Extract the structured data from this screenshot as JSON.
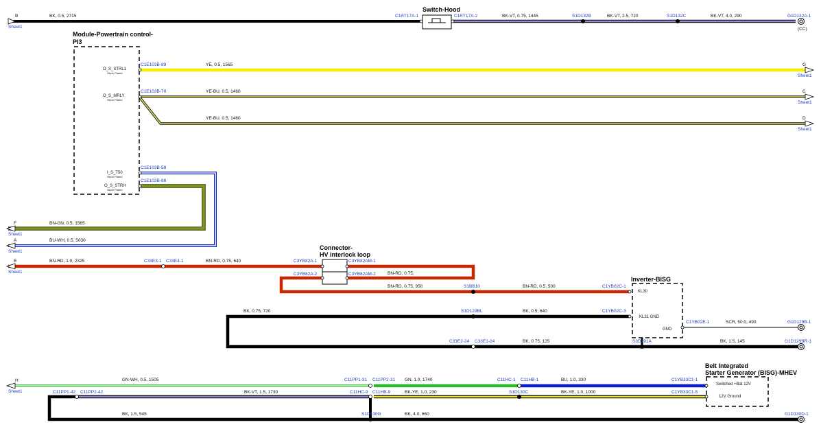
{
  "wires": {
    "w1": {
      "label": "BK, 0.5, 2715"
    },
    "w2": {
      "label": "BK-VT, 0.75, 1445"
    },
    "w3": {
      "label": "BK-VT, 2.5, 720"
    },
    "w4": {
      "label": "BK-VT, 4.0, 290"
    },
    "w5": {
      "label": "YE, 0.5, 1565"
    },
    "w6": {
      "label": "YE-BU, 0.5, 1460"
    },
    "w7": {
      "label": "YE-BU, 0.5, 1460"
    },
    "w8": {
      "label": "BN-GN, 0.5, 1565"
    },
    "w9": {
      "label": "BU-WH, 0.5, 5030"
    },
    "w10": {
      "label": "BN-RD, 1.0, 2325"
    },
    "w11": {
      "label": "BN-RD, 0.75, 640"
    },
    "w12": {
      "label": "BN-RD, 0.75,"
    },
    "w13": {
      "label": "BN-RD, 0.75, 950"
    },
    "w14": {
      "label": "BN-RD, 0.5, 500"
    },
    "w15": {
      "label": "BK, 0.75, 720"
    },
    "w16": {
      "label": "BK, 0.5, 640"
    },
    "w17": {
      "label": "SCR, 50.0, 490"
    },
    "w18": {
      "label": "BK, 0.75, 125"
    },
    "w19": {
      "label": "BK, 1.5, 145"
    },
    "w20": {
      "label": "GN-WH, 0.5, 1505"
    },
    "w21": {
      "label": "GN, 1.0, 1740"
    },
    "w22": {
      "label": "BU, 1.0, 330"
    },
    "w23": {
      "label": "BK-VT, 1.5, 1730"
    },
    "w24": {
      "label": "BK-YE, 1.0, 230"
    },
    "w25": {
      "label": "BK-YE, 1.0, 1000"
    },
    "w26": {
      "label": "BK, 1.5, 545"
    },
    "w27": {
      "label": "BK, 4.0, 660"
    }
  },
  "connectors": {
    "c1": "C1RT17A-1",
    "c2": "C1RT17A-2",
    "c3": "S1D132B",
    "c4": "S1D132C",
    "c5": "G1D132A-1",
    "c6": "C1E103B-89",
    "c7": "C1E103B-70",
    "c8": "C1E103B-58",
    "c9": "C1E103B-86",
    "c10": "C33E3-1",
    "c11": "C33E4-1",
    "c12": "C3YB82A-1",
    "c13": "C3YB82AM-1",
    "c14": "C3YB82A-2",
    "c15": "C3YB82AM-2",
    "c16": "S1BB10",
    "c17": "C1YB02C-1",
    "c18": "S1D129BL",
    "c19": "C1YB02C-3",
    "c20": "C1YB02E-1",
    "c21": "G1D129B-1",
    "c22": "C33E2-24",
    "c23": "C33E1-24",
    "c24": "S3D191A",
    "c25": "G1D129BR-1",
    "c26": "C11PP1-31",
    "c27": "C11PP2-31",
    "c28": "C11HC-1",
    "c29": "C11HB-1",
    "c30": "C1YB33C1-1",
    "c31": "C11PP1-42",
    "c32": "C11PP2-42",
    "c33": "C11HC-9",
    "c34": "C11HB-9",
    "c35": "S1D130C",
    "c36": "C1YB33C1-5",
    "c37": "S1D130G",
    "c38": "G1D130D-1"
  },
  "offsheet": {
    "b": {
      "letter": "B",
      "sheet": "Sheet1"
    },
    "g": {
      "letter": "G",
      "sheet": "Sheet1"
    },
    "c": {
      "letter": "C",
      "sheet": "Sheet1"
    },
    "d": {
      "letter": "D",
      "sheet": "Sheet1"
    },
    "f": {
      "letter": "F",
      "sheet": "Sheet1"
    },
    "a": {
      "letter": "A",
      "sheet": "Sheet1"
    },
    "e": {
      "letter": "E",
      "sheet": "Sheet1"
    },
    "h": {
      "letter": "H",
      "sheet": "Sheet1"
    }
  },
  "components": {
    "switch_hood": {
      "title": "Switch-Hood"
    },
    "pcm": {
      "title1": "Module-Powertrain control-",
      "title2": "PI3",
      "pins": {
        "p1": "O_S_STRL1",
        "p2": "O_S_MRLY",
        "p3": "I_S_T50",
        "p4": "O_S_STRH"
      },
      "plating": "Silver Plated"
    },
    "hv_loop": {
      "title1": "Connector-",
      "title2": "HV interlock loop"
    },
    "inverter": {
      "title": "Inverter-BISG",
      "pins": {
        "kl30": "KL30",
        "kl31": "KL31 GND",
        "gnd": "GND"
      }
    },
    "bisg": {
      "title1": "Belt Integrated",
      "title2": "Starter Generator (BISG)-MHEV",
      "pins": {
        "sw": "Switched +Bat 12V",
        "gnd": "12V Ground"
      }
    }
  },
  "misc": {
    "cc": "(CC)"
  },
  "colors": {
    "bk": "#000000",
    "vt": "#9b8ad8",
    "ye": "#f4f000",
    "gn": "#7a9a1a",
    "bu": "#0a1ec8",
    "rd": "#c82800",
    "greenbright": "#2fb82f",
    "whitewire": "#ffffff",
    "label_blue": "#1a3fc0"
  }
}
